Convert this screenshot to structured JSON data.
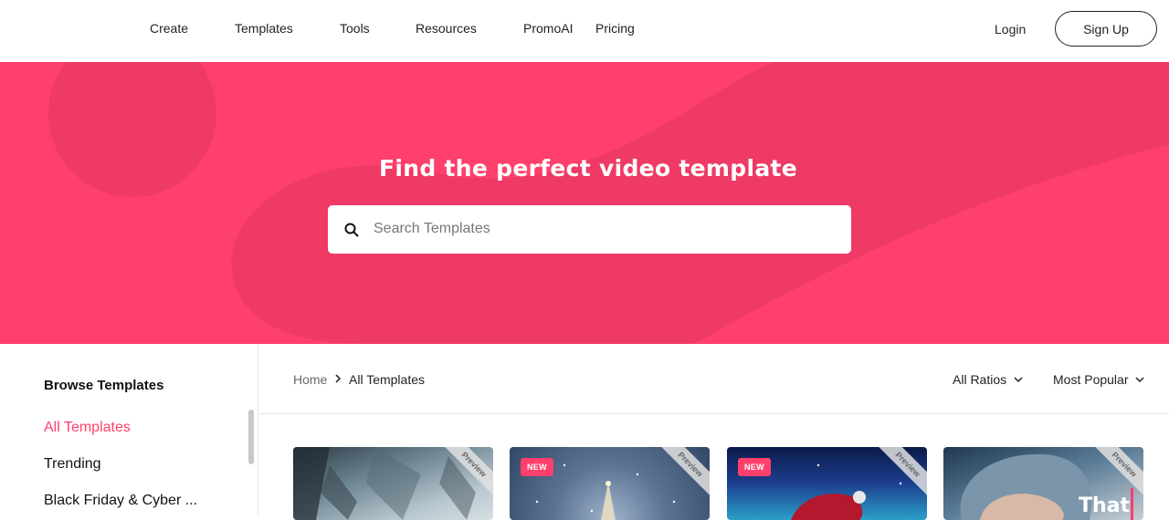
{
  "nav": {
    "links": [
      "Create",
      "Templates",
      "Tools",
      "Resources",
      "PromoAI",
      "Pricing"
    ],
    "login": "Login",
    "signup": "Sign Up"
  },
  "hero": {
    "title": "Find the perfect video template",
    "search_placeholder": "Search Templates",
    "bg_color": "#ff3f6c"
  },
  "sidebar": {
    "title": "Browse Templates",
    "items": [
      {
        "label": "All Templates",
        "active": true
      },
      {
        "label": "Trending",
        "active": false
      },
      {
        "label": "Black Friday & Cyber ...",
        "active": false
      }
    ]
  },
  "breadcrumb": {
    "home": "Home",
    "current": "All Templates"
  },
  "filters": {
    "ratio": "All Ratios",
    "sort": "Most Popular"
  },
  "cards": [
    {
      "badge": "",
      "ribbon": "Preview",
      "text": ""
    },
    {
      "badge": "NEW",
      "ribbon": "Preview",
      "text": ""
    },
    {
      "badge": "NEW",
      "ribbon": "Preview",
      "text": ""
    },
    {
      "badge": "",
      "ribbon": "Preview",
      "text": "That"
    }
  ],
  "colors": {
    "accent": "#ff3f6c"
  }
}
